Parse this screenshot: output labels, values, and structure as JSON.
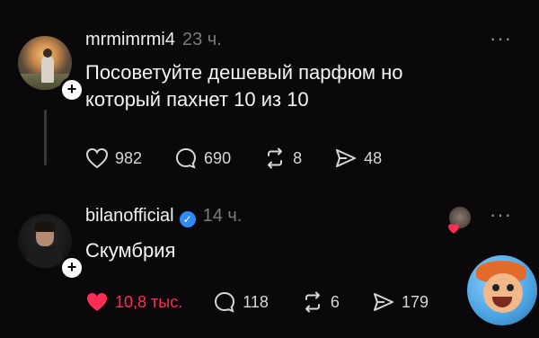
{
  "posts": [
    {
      "username": "mrmimrmi4",
      "time": "23 ч.",
      "more": "···",
      "text_lines": [
        "Посоветуйте дешевый парфюм но",
        "который пахнет 10 из 10"
      ],
      "likes": "982",
      "comments": "690",
      "reposts": "8",
      "shares": "48",
      "liked": false
    },
    {
      "username": "bilanofficial",
      "verified": true,
      "verified_glyph": "✓",
      "time": "14 ч.",
      "more": "···",
      "text_lines": [
        "Скумбрия"
      ],
      "likes": "10,8 тыс.",
      "comments": "118",
      "reposts": "6",
      "shares": "179",
      "liked": true
    }
  ],
  "badge_glyph": "+",
  "colors": {
    "background": "#0b080b",
    "like_active": "#ff2d55",
    "verified": "#2f8bf5",
    "muted": "#7c7a7c"
  },
  "icons": {
    "like": "heart-icon",
    "comment": "comment-icon",
    "repost": "repost-icon",
    "share": "send-icon",
    "verified": "verified-check-icon",
    "more": "more-dots-icon"
  }
}
